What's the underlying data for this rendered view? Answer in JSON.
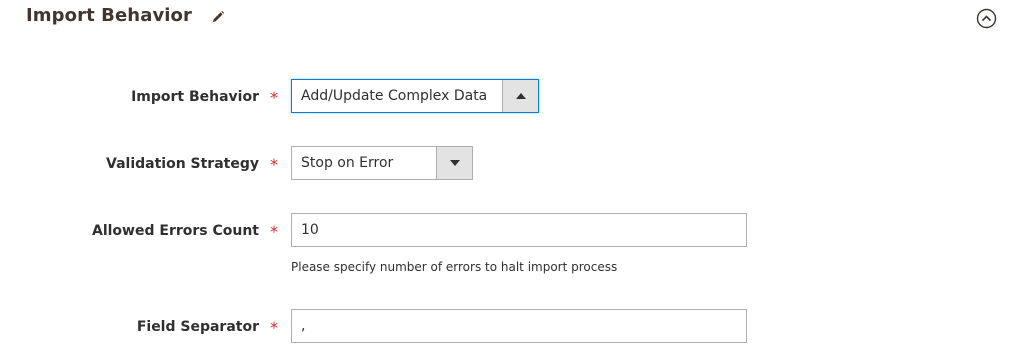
{
  "section": {
    "title": "Import Behavior",
    "edit_icon": "pencil-icon",
    "collapse_icon": "chevron-up-circle-icon"
  },
  "fields": {
    "import_behavior": {
      "label": "Import Behavior",
      "required": "*",
      "value": "Add/Update Complex Data",
      "arrow_icon": "caret-up-icon"
    },
    "validation_strategy": {
      "label": "Validation Strategy",
      "required": "*",
      "value": "Stop on Error",
      "arrow_icon": "caret-down-icon"
    },
    "allowed_errors_count": {
      "label": "Allowed Errors Count",
      "required": "*",
      "value": "10",
      "note": "Please specify number of errors to halt import process"
    },
    "field_separator": {
      "label": "Field Separator",
      "required": "*",
      "value": ","
    }
  },
  "colors": {
    "required": "#e22626",
    "focus": "#007bdb",
    "title": "#41362f"
  }
}
